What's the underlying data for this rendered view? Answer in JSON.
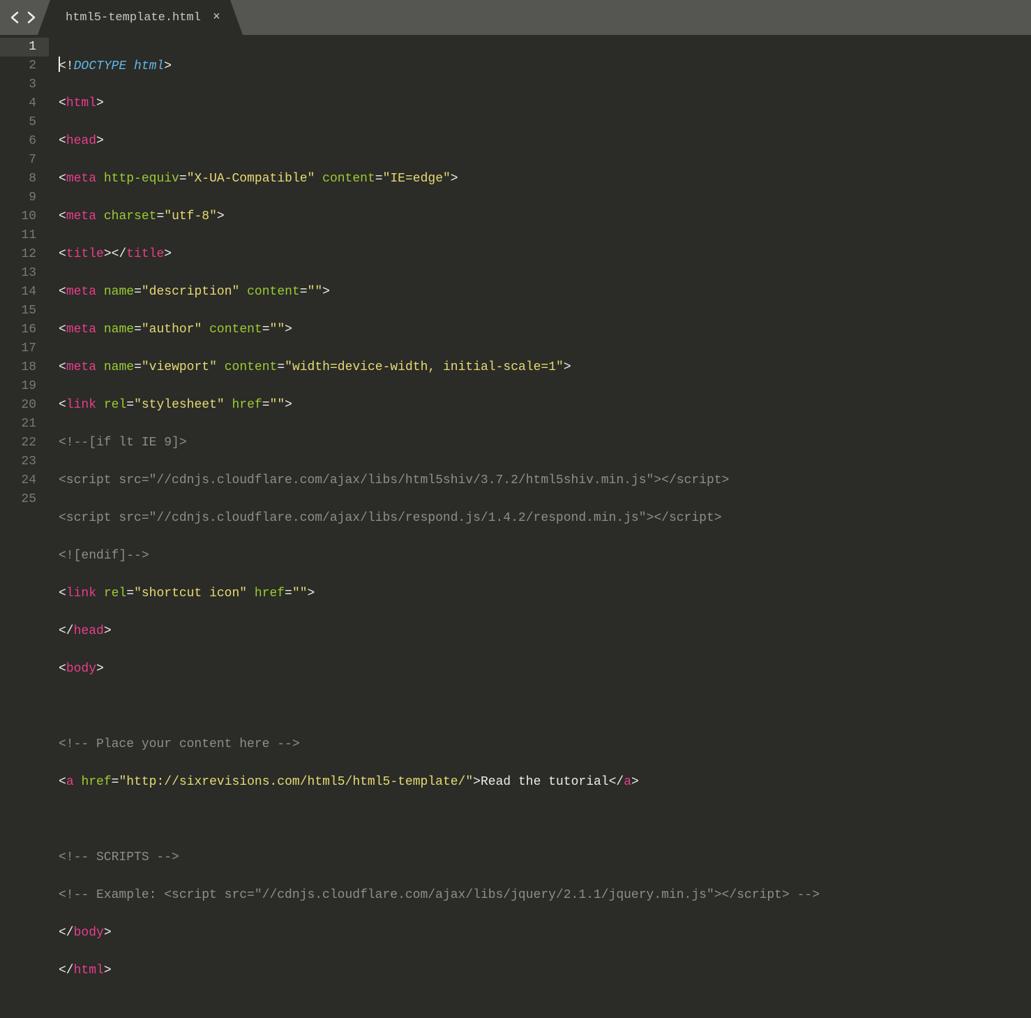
{
  "tab": {
    "title": "html5-template.html",
    "close": "×"
  },
  "line_numbers": [
    "1",
    "2",
    "3",
    "4",
    "5",
    "6",
    "7",
    "8",
    "9",
    "10",
    "11",
    "12",
    "13",
    "14",
    "15",
    "16",
    "17",
    "18",
    "19",
    "20",
    "21",
    "22",
    "23",
    "24",
    "25"
  ],
  "active_line": 1,
  "code": {
    "l1": {
      "lt": "<!",
      "kw": "DOCTYPE html",
      "gt": ">"
    },
    "l2": {
      "lt": "<",
      "tag": "html",
      "gt": ">"
    },
    "l3": {
      "lt": "<",
      "tag": "head",
      "gt": ">"
    },
    "l4": {
      "lt": "<",
      "tag": "meta",
      "sp": " ",
      "a1": "http-equiv",
      "eq1": "=",
      "v1": "\"X-UA-Compatible\"",
      "sp2": " ",
      "a2": "content",
      "eq2": "=",
      "v2": "\"IE=edge\"",
      "gt": ">"
    },
    "l5": {
      "lt": "<",
      "tag": "meta",
      "sp": " ",
      "a1": "charset",
      "eq1": "=",
      "v1": "\"utf-8\"",
      "gt": ">"
    },
    "l6": {
      "lt": "<",
      "tag": "title",
      "gt": ">",
      "lt2": "</",
      "tag2": "title",
      "gt2": ">"
    },
    "l7": {
      "lt": "<",
      "tag": "meta",
      "sp": " ",
      "a1": "name",
      "eq1": "=",
      "v1": "\"description\"",
      "sp2": " ",
      "a2": "content",
      "eq2": "=",
      "v2": "\"\"",
      "gt": ">"
    },
    "l8": {
      "lt": "<",
      "tag": "meta",
      "sp": " ",
      "a1": "name",
      "eq1": "=",
      "v1": "\"author\"",
      "sp2": " ",
      "a2": "content",
      "eq2": "=",
      "v2": "\"\"",
      "gt": ">"
    },
    "l9": {
      "lt": "<",
      "tag": "meta",
      "sp": " ",
      "a1": "name",
      "eq1": "=",
      "v1": "\"viewport\"",
      "sp2": " ",
      "a2": "content",
      "eq2": "=",
      "v2": "\"width=device-width, initial-scale=1\"",
      "gt": ">"
    },
    "l10": {
      "lt": "<",
      "tag": "link",
      "sp": " ",
      "a1": "rel",
      "eq1": "=",
      "v1": "\"stylesheet\"",
      "sp2": " ",
      "a2": "href",
      "eq2": "=",
      "v2": "\"\"",
      "gt": ">"
    },
    "l11": {
      "c": "<!--[if lt IE 9]>"
    },
    "l12": {
      "c": "<script src=\"//cdnjs.cloudflare.com/ajax/libs/html5shiv/3.7.2/html5shiv.min.js\"></scr"
    },
    "l12b": {
      "c": "ipt>"
    },
    "l13": {
      "c": "<script src=\"//cdnjs.cloudflare.com/ajax/libs/respond.js/1.4.2/respond.min.js\"></scr"
    },
    "l13b": {
      "c": "ipt>"
    },
    "l14": {
      "c": "<![endif]-->"
    },
    "l15": {
      "lt": "<",
      "tag": "link",
      "sp": " ",
      "a1": "rel",
      "eq1": "=",
      "v1": "\"shortcut icon\"",
      "sp2": " ",
      "a2": "href",
      "eq2": "=",
      "v2": "\"\"",
      "gt": ">"
    },
    "l16": {
      "lt": "</",
      "tag": "head",
      "gt": ">"
    },
    "l17": {
      "lt": "<",
      "tag": "body",
      "gt": ">"
    },
    "l18": {},
    "l19": {
      "c": "<!-- Place your content here -->"
    },
    "l20": {
      "lt": "<",
      "tag": "a",
      "sp": " ",
      "a1": "href",
      "eq1": "=",
      "v1": "\"http://sixrevisions.com/html5/html5-template/\"",
      "gt": ">",
      "text": "Read the tutorial",
      "lt2": "</",
      "tag2": "a",
      "gt2": ">"
    },
    "l21": {},
    "l22": {
      "c": "<!-- SCRIPTS -->"
    },
    "l23a": {
      "c": "<!-- Example: <script src=\"//cdnjs.cloudflare.com/ajax/libs/jquery/2.1.1/jquery.min.js\"></scr"
    },
    "l23b": {
      "c": "ipt> -->"
    },
    "l24": {
      "lt": "</",
      "tag": "body",
      "gt": ">"
    },
    "l25": {
      "lt": "</",
      "tag": "html",
      "gt": ">"
    }
  }
}
